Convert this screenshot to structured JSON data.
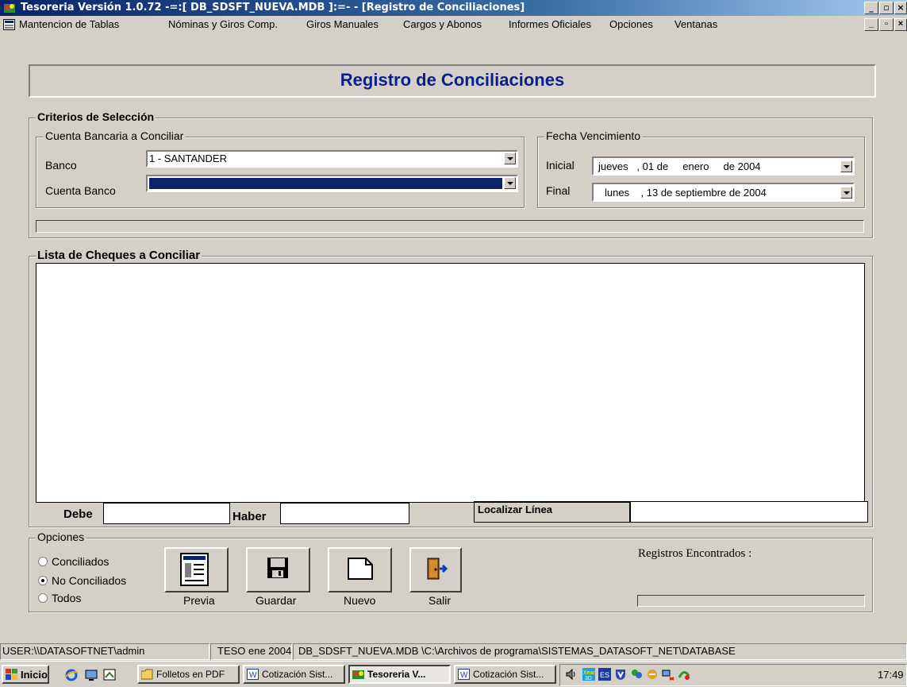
{
  "window": {
    "title": "Tesoreria  Versión 1.0.72       -=:[  DB_SDSFT_NUEVA.MDB  ]:=-  - [Registro de Conciliaciones]"
  },
  "menu": {
    "items": [
      "Mantencion de Tablas",
      "Nóminas y Giros Comp.",
      "Giros Manuales",
      "Cargos y Abonos",
      "Informes Oficiales",
      "Opciones",
      "Ventanas"
    ]
  },
  "form": {
    "heading": "Registro de Conciliaciones",
    "criteria": {
      "legend": "Criterios de Selección",
      "account_group_legend": "Cuenta Bancaria a Conciliar",
      "bank_label": "Banco",
      "bank_value": "1 - SANTANDER",
      "account_label": "Cuenta Banco",
      "account_value": "",
      "date_group_legend": "Fecha Vencimiento",
      "start_label": "Inicial",
      "start_value": "jueves   , 01 de     enero     de 2004",
      "end_label": "Final",
      "end_value": "lunes    , 13 de septiembre de 2004"
    },
    "list": {
      "legend": "Lista de Cheques a Conciliar",
      "debit_label": "Debe",
      "debit_value": "",
      "credit_label": "Haber",
      "credit_value": "",
      "locate_label": "Localizar Línea",
      "locate_value": ""
    },
    "options": {
      "legend": "Opciones",
      "radios": [
        {
          "label": "Conciliados",
          "selected": false
        },
        {
          "label": "No Conciliados",
          "selected": true
        },
        {
          "label": "Todos",
          "selected": false
        }
      ],
      "records_label": "Registros Encontrados :"
    },
    "buttons": {
      "preview": "Previa",
      "save": "Guardar",
      "new": "Nuevo",
      "exit": "Salir"
    }
  },
  "statusbar": {
    "user": "USER:\\\\DATASOFTNET\\admin",
    "period": "TESO ene 2004",
    "path": "DB_SDSFT_NUEVA.MDB \\C:\\Archivos de programa\\SISTEMAS_DATASOFT_NET\\DATABASE"
  },
  "taskbar": {
    "start": "Inicio",
    "tasks": [
      "Folletos en PDF",
      "Cotización Sist...",
      "Tesoreria  V...",
      "Cotización Sist..."
    ],
    "clock": "17:49"
  },
  "colors": {
    "title_gradient_start": "#0a246a",
    "heading_text": "#0a1f8f",
    "selection": "#0a246a"
  }
}
